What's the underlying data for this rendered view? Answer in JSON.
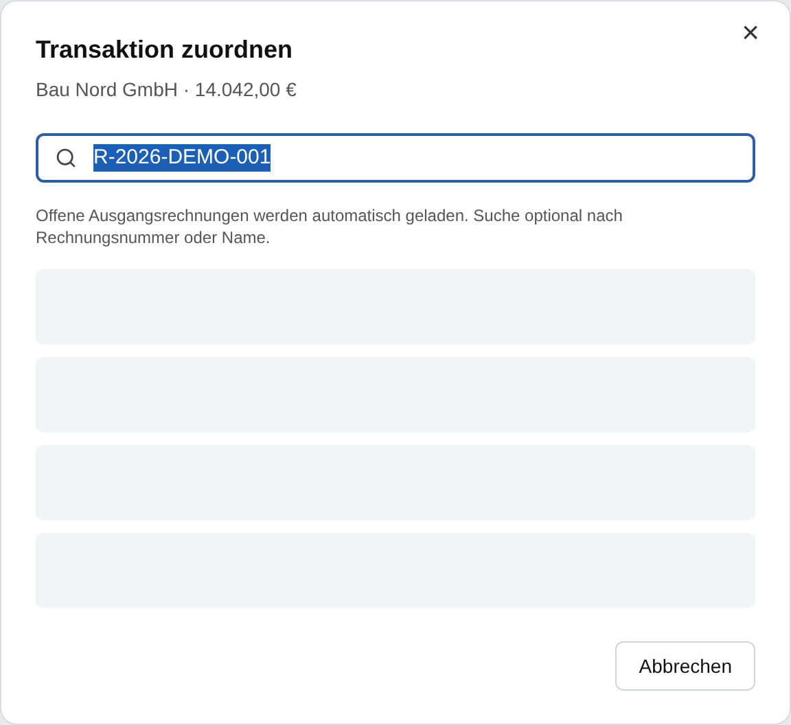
{
  "dialog": {
    "title": "Transaktion zuordnen",
    "subtitle": "Bau Nord GmbH · 14.042,00 €",
    "close_label": "×"
  },
  "search": {
    "value": "R-2026-DEMO-001",
    "text_selected": true,
    "focused": true
  },
  "hint": "Offene Ausgangsrechnungen werden automatisch geladen. Suche optional nach Rechnungsnummer oder Name.",
  "results": [
    {
      "kind": "skeleton"
    },
    {
      "kind": "skeleton"
    },
    {
      "kind": "skeleton"
    },
    {
      "kind": "skeleton"
    }
  ],
  "buttons": [
    "Abbrechen"
  ]
}
